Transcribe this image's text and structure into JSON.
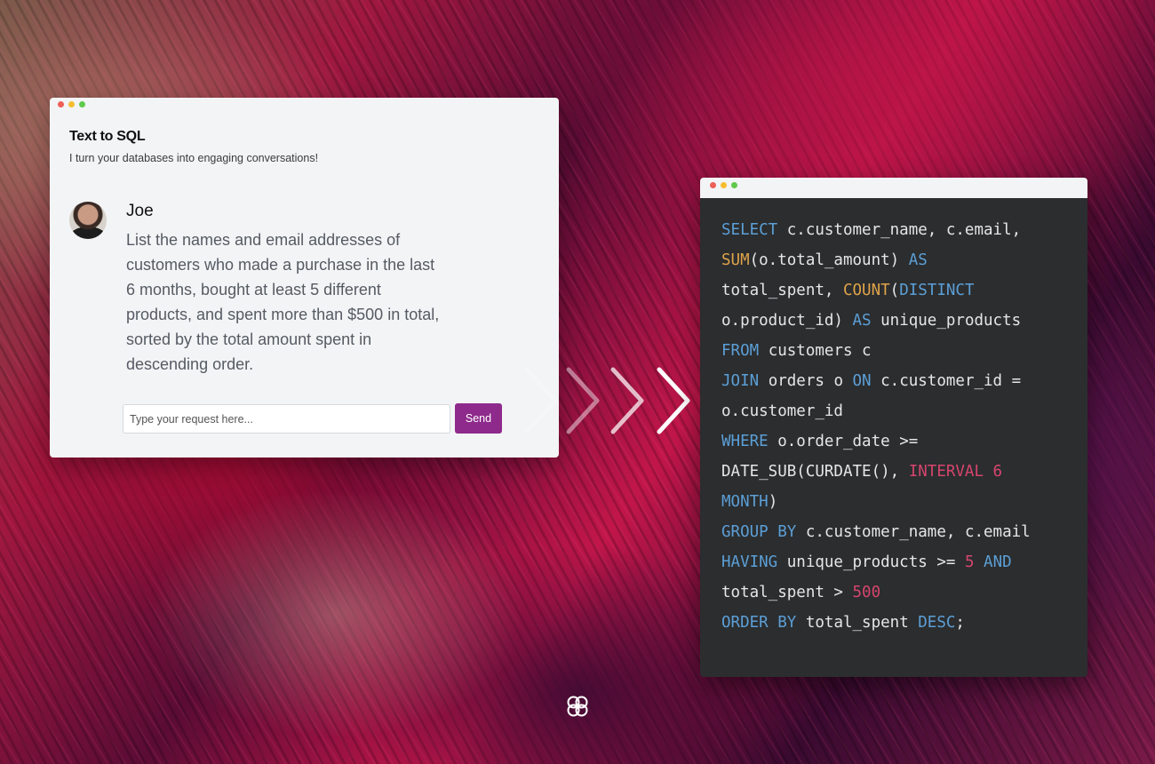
{
  "chat_window": {
    "title": "Text to SQL",
    "subtitle": "I turn your databases into engaging conversations!",
    "message": {
      "sender": "Joe",
      "text": "List the names and email addresses of customers who made a purchase in the last 6 months, bought at least 5 different products, and spent more than $500 in total, sorted by the total amount spent in descending order."
    },
    "input": {
      "placeholder": "Type your request here...",
      "value": ""
    },
    "send_label": "Send"
  },
  "code_window": {
    "lines": [
      [
        {
          "t": "kw",
          "v": "SELECT"
        },
        {
          "t": "plain",
          "v": " c.customer_name, c.email,"
        }
      ],
      [
        {
          "t": "fn",
          "v": "SUM"
        },
        {
          "t": "plain",
          "v": "(o.total_amount) "
        },
        {
          "t": "kw",
          "v": "AS"
        }
      ],
      [
        {
          "t": "plain",
          "v": "total_spent, "
        },
        {
          "t": "fn",
          "v": "COUNT"
        },
        {
          "t": "plain",
          "v": "("
        },
        {
          "t": "kw",
          "v": "DISTINCT"
        }
      ],
      [
        {
          "t": "plain",
          "v": "o.product_id) "
        },
        {
          "t": "kw",
          "v": "AS"
        },
        {
          "t": "plain",
          "v": " unique_products"
        }
      ],
      [
        {
          "t": "kw",
          "v": "FROM"
        },
        {
          "t": "plain",
          "v": " customers c"
        }
      ],
      [
        {
          "t": "kw",
          "v": "JOIN"
        },
        {
          "t": "plain",
          "v": " orders o "
        },
        {
          "t": "kw",
          "v": "ON"
        },
        {
          "t": "plain",
          "v": " c.customer_id ="
        }
      ],
      [
        {
          "t": "plain",
          "v": "o.customer_id"
        }
      ],
      [
        {
          "t": "kw",
          "v": "WHERE"
        },
        {
          "t": "plain",
          "v": " o.order_date >="
        }
      ],
      [
        {
          "t": "plain",
          "v": "DATE_SUB(CURDATE(), "
        },
        {
          "t": "num",
          "v": "INTERVAL 6"
        }
      ],
      [
        {
          "t": "kw",
          "v": "MONTH"
        },
        {
          "t": "plain",
          "v": ")"
        }
      ],
      [
        {
          "t": "kw",
          "v": "GROUP BY"
        },
        {
          "t": "plain",
          "v": " c.customer_name, c.email"
        }
      ],
      [
        {
          "t": "kw",
          "v": "HAVING"
        },
        {
          "t": "plain",
          "v": " unique_products >= "
        },
        {
          "t": "num",
          "v": "5"
        },
        {
          "t": "plain",
          "v": " "
        },
        {
          "t": "kw",
          "v": "AND"
        }
      ],
      [
        {
          "t": "plain",
          "v": "total_spent > "
        },
        {
          "t": "num",
          "v": "500"
        }
      ],
      [
        {
          "t": "kw",
          "v": "ORDER BY"
        },
        {
          "t": "plain",
          "v": " total_spent "
        },
        {
          "t": "kw",
          "v": "DESC"
        },
        {
          "t": "plain",
          "v": ";"
        }
      ]
    ]
  },
  "icons": {
    "window_controls": [
      "close-dot",
      "minimize-dot",
      "maximize-dot"
    ],
    "flow": "chevron-right-icon",
    "brand": "brand-logo-icon"
  },
  "colors": {
    "send_button": "#8e2a8b",
    "code_background": "#2b2d2f",
    "keyword": "#5c9fd6",
    "function": "#e0a44a",
    "number": "#d6456c"
  }
}
